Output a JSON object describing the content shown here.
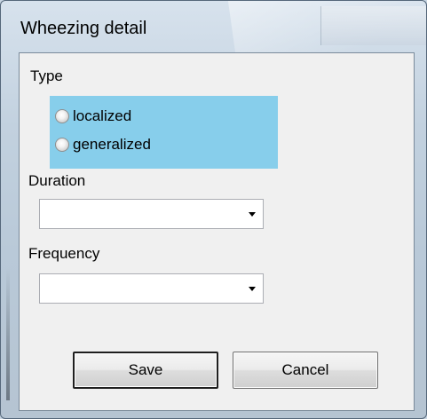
{
  "window": {
    "title": "Wheezing detail"
  },
  "type_group": {
    "label": "Type",
    "options": [
      {
        "label": "localized",
        "selected": false
      },
      {
        "label": "generalized",
        "selected": false
      }
    ],
    "highlight_color": "#87ceeb"
  },
  "duration": {
    "label": "Duration",
    "value": ""
  },
  "frequency": {
    "label": "Frequency",
    "value": ""
  },
  "buttons": {
    "save_label": "Save",
    "cancel_label": "Cancel"
  },
  "colors": {
    "client_background": "#f0f0f0",
    "default_button_border": "#1f1f1f"
  }
}
